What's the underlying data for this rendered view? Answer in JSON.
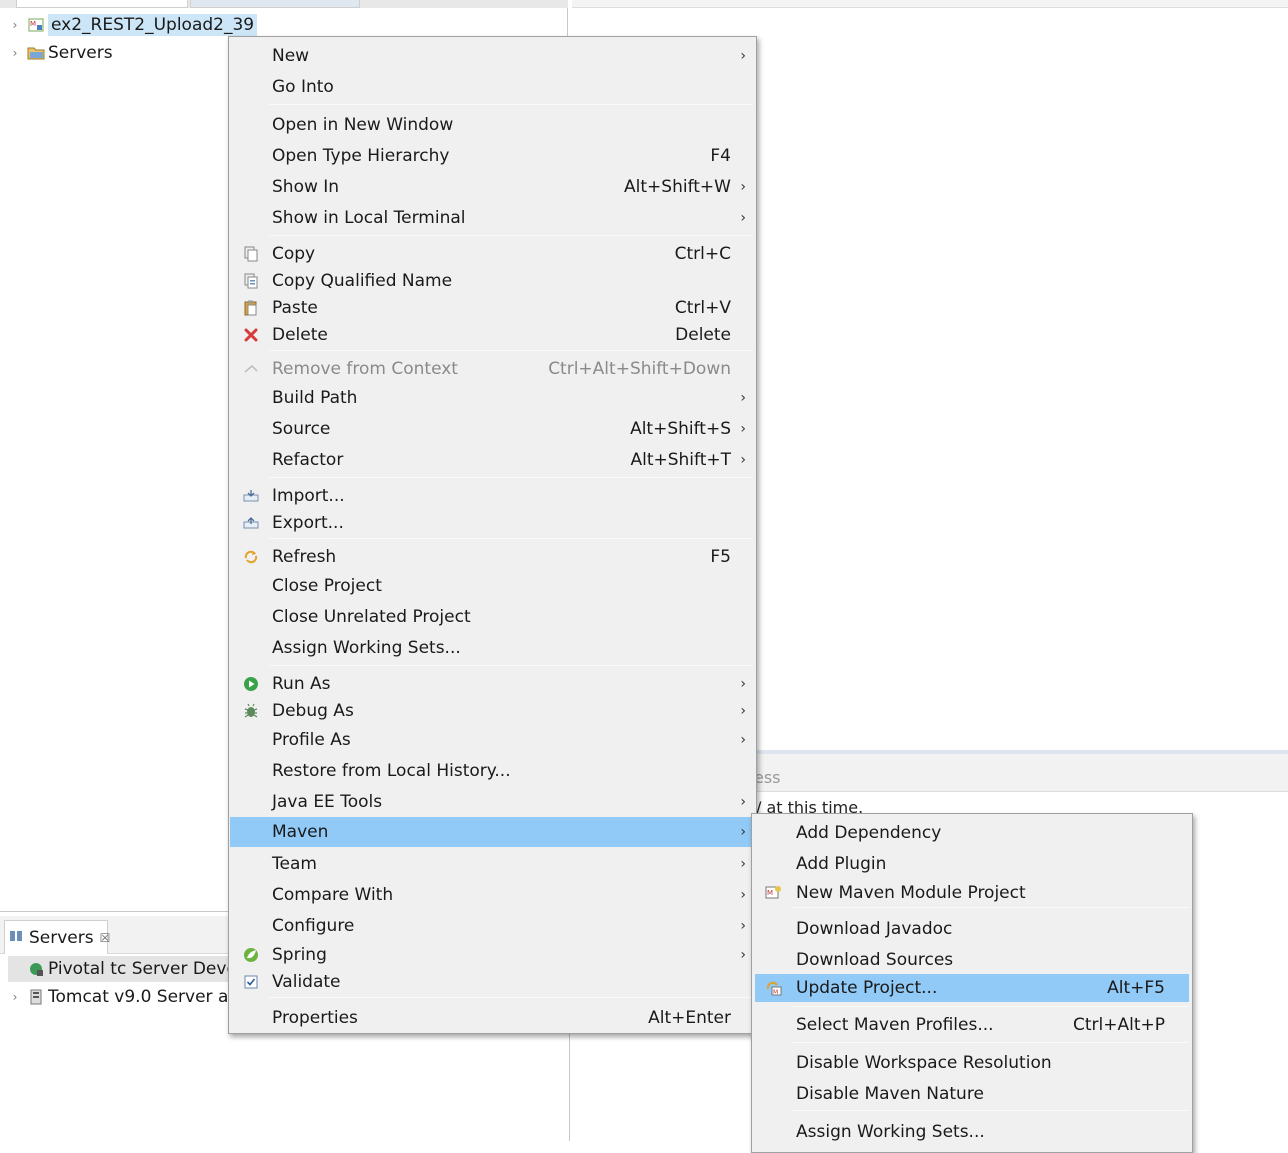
{
  "explorer": {
    "tree": [
      {
        "label": "ex2_REST2_Upload2_39",
        "icon": "maven-project-icon",
        "selected": true
      },
      {
        "label": "Servers",
        "icon": "folder-icon",
        "selected": false
      }
    ]
  },
  "problems": {
    "tab_fragment": "ess",
    "message_fragment": "/ at this time."
  },
  "servers": {
    "tab_label": "Servers",
    "rows": [
      {
        "label": "Pivotal tc Server Deve",
        "icon": "pivotal-server-icon"
      },
      {
        "label": "Tomcat v9.0 Server at",
        "icon": "tomcat-server-icon"
      }
    ]
  },
  "context_menu": {
    "items": [
      {
        "label": "New",
        "submenu": true
      },
      {
        "label": "Go Into"
      },
      {
        "label": "Open in New Window"
      },
      {
        "label": "Open Type Hierarchy",
        "shortcut": "F4"
      },
      {
        "label": "Show In",
        "shortcut": "Alt+Shift+W",
        "submenu": true
      },
      {
        "label": "Show in Local Terminal",
        "submenu": true
      },
      {
        "label": "Copy",
        "shortcut": "Ctrl+C",
        "icon": "copy-icon"
      },
      {
        "label": "Copy Qualified Name",
        "icon": "copy-qualified-icon"
      },
      {
        "label": "Paste",
        "shortcut": "Ctrl+V",
        "icon": "paste-icon"
      },
      {
        "label": "Delete",
        "shortcut": "Delete",
        "icon": "delete-icon"
      },
      {
        "label": "Remove from Context",
        "shortcut": "Ctrl+Alt+Shift+Down",
        "icon": "remove-context-icon",
        "disabled": true
      },
      {
        "label": "Build Path",
        "submenu": true
      },
      {
        "label": "Source",
        "shortcut": "Alt+Shift+S",
        "submenu": true
      },
      {
        "label": "Refactor",
        "shortcut": "Alt+Shift+T",
        "submenu": true
      },
      {
        "label": "Import...",
        "icon": "import-icon"
      },
      {
        "label": "Export...",
        "icon": "export-icon"
      },
      {
        "label": "Refresh",
        "shortcut": "F5",
        "icon": "refresh-icon"
      },
      {
        "label": "Close Project"
      },
      {
        "label": "Close Unrelated Project"
      },
      {
        "label": "Assign Working Sets..."
      },
      {
        "label": "Run As",
        "submenu": true,
        "icon": "run-icon"
      },
      {
        "label": "Debug As",
        "submenu": true,
        "icon": "debug-icon"
      },
      {
        "label": "Profile As",
        "submenu": true
      },
      {
        "label": "Restore from Local History..."
      },
      {
        "label": "Java EE Tools",
        "submenu": true
      },
      {
        "label": "Maven",
        "submenu": true,
        "highlighted": true
      },
      {
        "label": "Team",
        "submenu": true
      },
      {
        "label": "Compare With",
        "submenu": true
      },
      {
        "label": "Configure",
        "submenu": true
      },
      {
        "label": "Spring",
        "submenu": true,
        "icon": "spring-icon"
      },
      {
        "label": "Validate",
        "icon": "validate-checkbox-icon"
      },
      {
        "label": "Properties",
        "shortcut": "Alt+Enter"
      }
    ]
  },
  "maven_submenu": {
    "items": [
      {
        "label": "Add Dependency"
      },
      {
        "label": "Add Plugin"
      },
      {
        "label": "New Maven Module Project",
        "icon": "maven-module-icon"
      },
      {
        "label": "Download Javadoc"
      },
      {
        "label": "Download Sources"
      },
      {
        "label": "Update Project...",
        "shortcut": "Alt+F5",
        "icon": "maven-update-icon",
        "highlighted": true
      },
      {
        "label": "Select Maven Profiles...",
        "shortcut": "Ctrl+Alt+P"
      },
      {
        "label": "Disable Workspace Resolution"
      },
      {
        "label": "Disable Maven Nature"
      },
      {
        "label": "Assign Working Sets..."
      }
    ]
  },
  "colors": {
    "menu_background": "#f0f0f0",
    "highlight": "#91c9f7",
    "tree_selection": "#cde6f7",
    "disabled_text": "#8a8a8a"
  }
}
